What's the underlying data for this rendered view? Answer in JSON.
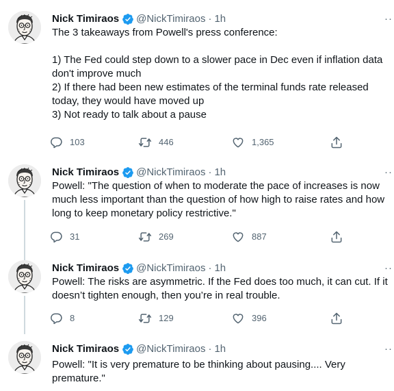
{
  "author": {
    "name": "Nick Timiraos",
    "handle": "@NickTimiraos",
    "separator": "·",
    "more_label": "··",
    "verified_color": "#1d9bf0"
  },
  "tweets": [
    {
      "time": "1h",
      "text": "The 3 takeaways from Powell's press conference:\n\n1) The Fed could step down to a slower pace in Dec even if inflation data don't improve much\n2) If there had been new estimates of the terminal funds rate released today, they would have moved up\n3) Not ready to talk about a pause",
      "replies": "103",
      "retweets": "446",
      "likes": "1,365"
    },
    {
      "time": "1h",
      "text": "Powell: \"The question of when to moderate the pace of increases is now much less important than the question of how high to raise rates and how long to keep monetary policy restrictive.\"",
      "replies": "31",
      "retweets": "269",
      "likes": "887"
    },
    {
      "time": "1h",
      "text": "Powell: The risks are asymmetric. If the Fed does too much, it can cut. If it doesn’t tighten enough, then you’re in real trouble.",
      "replies": "8",
      "retweets": "129",
      "likes": "396"
    },
    {
      "time": "1h",
      "text": "Powell: \"It is very premature to be thinking about pausing.... Very premature.\""
    }
  ],
  "icons": {
    "reply": "reply-icon",
    "retweet": "retweet-icon",
    "like": "heart-icon",
    "share": "share-icon",
    "verified": "verified-badge-icon",
    "more": "more-options-icon"
  }
}
